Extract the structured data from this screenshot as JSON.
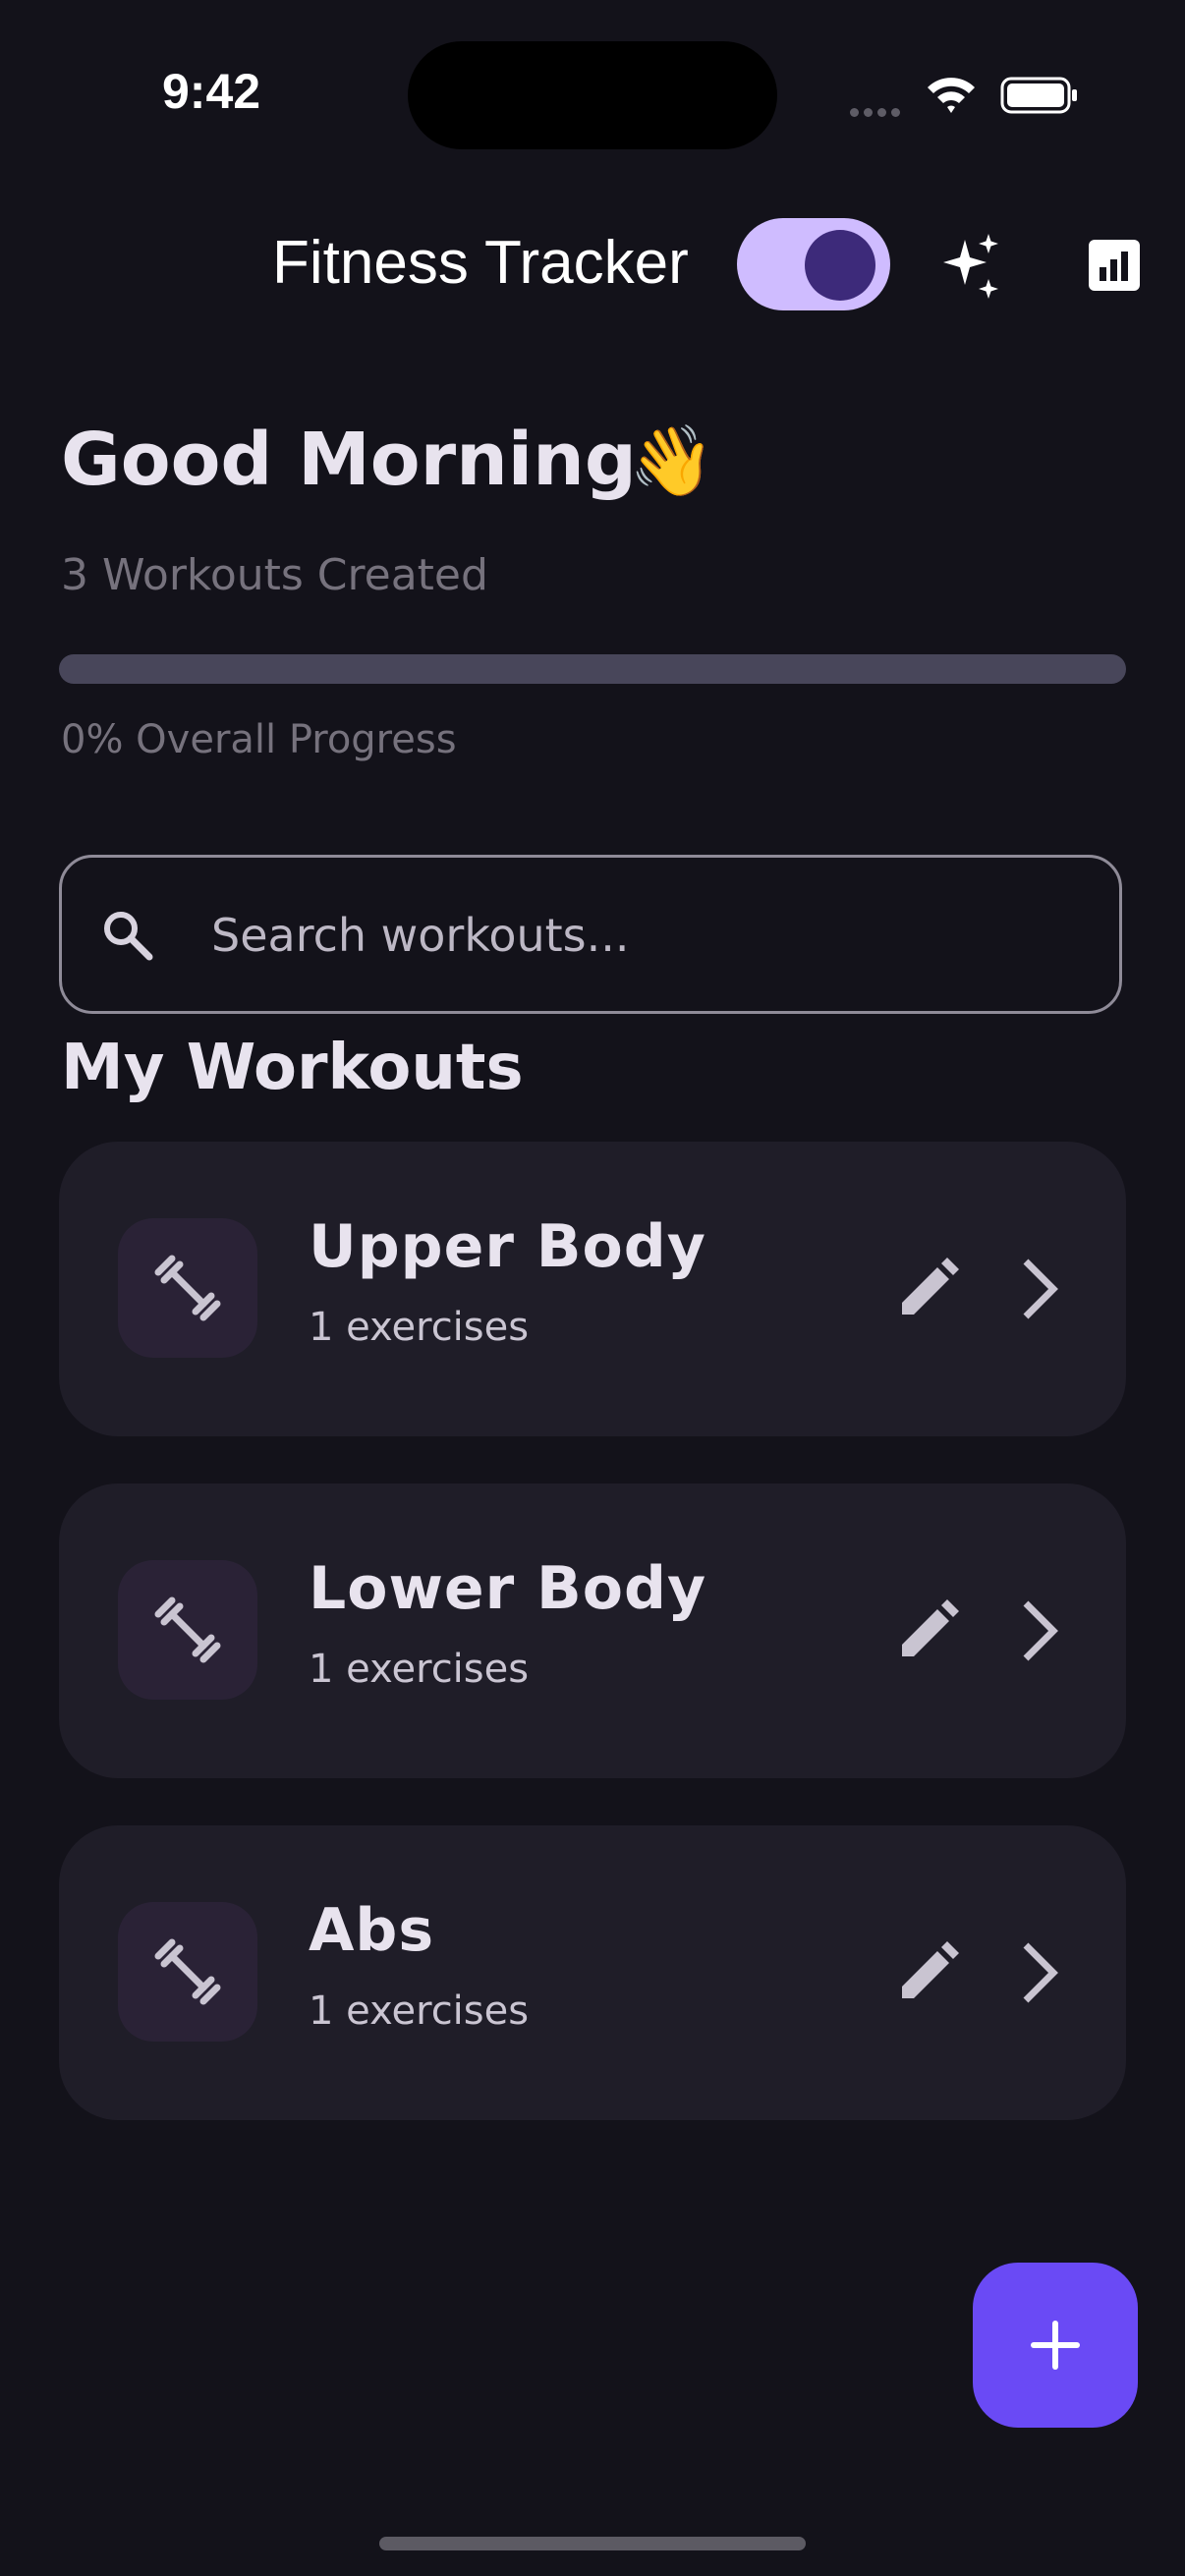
{
  "status_bar": {
    "time": "9:42"
  },
  "app_bar": {
    "title": "Fitness Tracker",
    "icons": [
      "theme-toggle",
      "sparkle-icon",
      "stats-icon"
    ]
  },
  "greeting": {
    "title": "Good Morning",
    "emoji": "👋",
    "workouts_created": "3 Workouts Created",
    "progress_percent": 0,
    "progress_label": "0% Overall Progress"
  },
  "search": {
    "placeholder": "Search workouts...",
    "value": ""
  },
  "section_title": "My Workouts",
  "workouts": [
    {
      "name": "Upper Body",
      "subtitle": "1 exercises"
    },
    {
      "name": "Lower Body",
      "subtitle": "1 exercises"
    },
    {
      "name": "Abs",
      "subtitle": "1 exercises"
    }
  ],
  "colors": {
    "background": "#13121a",
    "card": "#1f1d28",
    "accent": "#6a4af5",
    "toggle_track": "#cfbcff",
    "toggle_knob": "#3d2a7a"
  }
}
